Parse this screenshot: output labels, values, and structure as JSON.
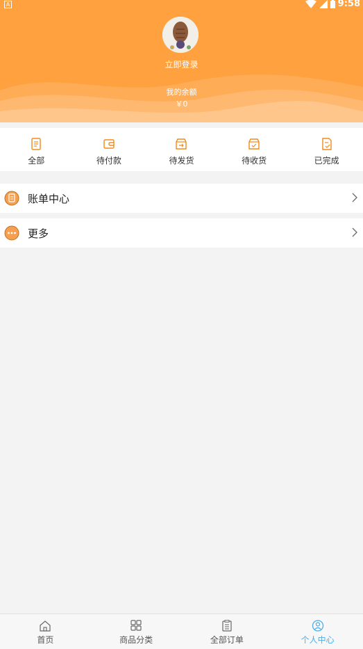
{
  "status_bar": {
    "left_badge": "A",
    "time": "9:58"
  },
  "profile": {
    "login_label": "立即登录",
    "balance_label": "我的余额",
    "balance_value": "￥0"
  },
  "orders": [
    {
      "label": "全部",
      "icon": "document-icon"
    },
    {
      "label": "待付款",
      "icon": "wallet-icon"
    },
    {
      "label": "待发货",
      "icon": "box-send-icon"
    },
    {
      "label": "待收货",
      "icon": "box-receive-icon"
    },
    {
      "label": "已完成",
      "icon": "completed-doc-icon"
    }
  ],
  "menu": [
    {
      "label": "账单中心",
      "icon": "bill-icon"
    },
    {
      "label": "更多",
      "icon": "more-icon"
    }
  ],
  "tabs": [
    {
      "label": "首页",
      "icon": "home-icon",
      "active": false
    },
    {
      "label": "商品分类",
      "icon": "grid-icon",
      "active": false
    },
    {
      "label": "全部订单",
      "icon": "clipboard-icon",
      "active": false
    },
    {
      "label": "个人中心",
      "icon": "user-icon",
      "active": true
    }
  ],
  "colors": {
    "brand_orange": "#ffa13f",
    "active_tab": "#4aaee8",
    "background": "#f3f3f3"
  }
}
